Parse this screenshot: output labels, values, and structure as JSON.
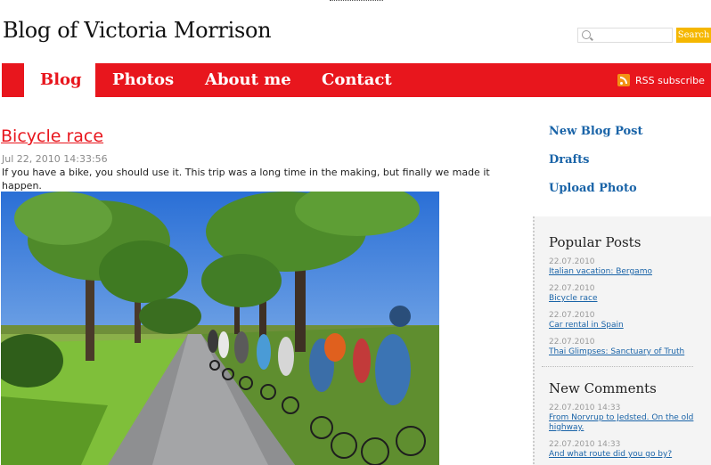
{
  "header": {
    "site_title": "Blog of Victoria Morrison",
    "search_placeholder": "",
    "search_button": "Search"
  },
  "nav": {
    "items": [
      {
        "label": "Blog"
      },
      {
        "label": "Photos"
      },
      {
        "label": "About me"
      },
      {
        "label": "Contact"
      }
    ],
    "rss_label": "RSS subscribe"
  },
  "post": {
    "title": "Bicycle race",
    "date": "Jul 22, 2010 14:33:56",
    "body": "If you have a bike, you should use it. This trip was a long time in the making, but finally we made it happen."
  },
  "sidebar": {
    "actions": [
      {
        "label": "New Blog Post"
      },
      {
        "label": "Drafts"
      },
      {
        "label": "Upload Photo"
      }
    ],
    "popular": {
      "heading": "Popular Posts",
      "items": [
        {
          "date": "22.07.2010",
          "title": "Italian vacation: Bergamo"
        },
        {
          "date": "22.07.2010",
          "title": "Bicycle race"
        },
        {
          "date": "22.07.2010",
          "title": "Car rental in Spain"
        },
        {
          "date": "22.07.2010",
          "title": "Thai Glimpses: Sanctuary of Truth"
        }
      ]
    },
    "comments": {
      "heading": "New Comments",
      "items": [
        {
          "date": "22.07.2010 14:33",
          "text": "From Norvrup to Jedsted. On the old highway."
        },
        {
          "date": "22.07.2010 14:33",
          "text": "And what route did you go by?"
        }
      ]
    }
  },
  "colors": {
    "brand_red": "#e8161d",
    "link_blue": "#1a64a8",
    "search_button": "#f5b700",
    "rss_orange": "#f39214"
  }
}
